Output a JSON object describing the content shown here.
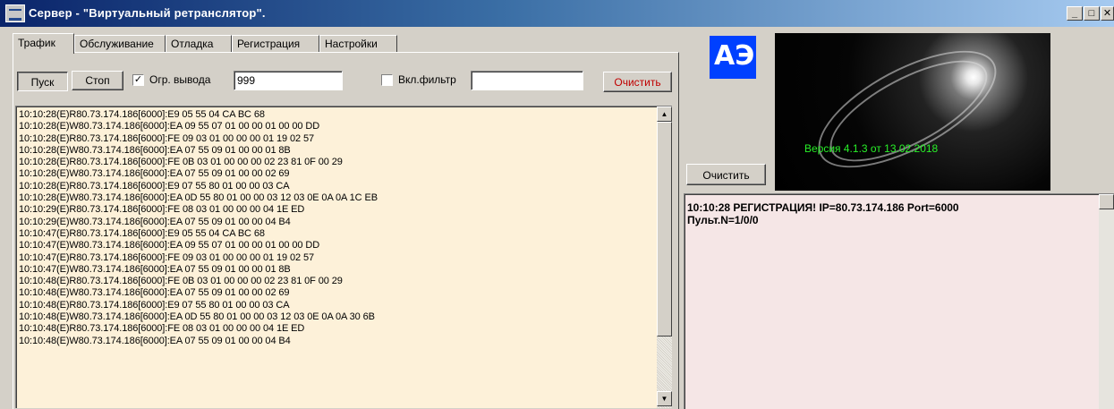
{
  "window": {
    "title": "Сервер - \"Виртуальный ретранслятор\".",
    "min_glyph": "_",
    "max_glyph": "□",
    "close_glyph": "✕"
  },
  "tabs": [
    {
      "label": "Трафик",
      "active": true
    },
    {
      "label": "Обслуживание",
      "active": false
    },
    {
      "label": "Отладка",
      "active": false
    },
    {
      "label": "Регистрация",
      "active": false
    },
    {
      "label": "Настройки",
      "active": false
    }
  ],
  "traffic": {
    "start_label": "Пуск",
    "stop_label": "Стоп",
    "limit_checked": true,
    "limit_label": "Огр. вывода",
    "limit_value": "999",
    "filter_checked": false,
    "filter_label": "Вкл.фильтр",
    "filter_value": "",
    "clear_label": "Очистить",
    "clear_color": "#c00000",
    "log_background": "#fdf1d9",
    "log_lines": [
      "10:10:28(E)R80.73.174.186[6000]:E9 05 55 04 CA BC 68",
      "10:10:28(E)W80.73.174.186[6000]:EA 09 55 07 01 00 00 01 00 00 DD",
      "10:10:28(E)R80.73.174.186[6000]:FE 09 03 01 00 00 00 01 19 02 57",
      "10:10:28(E)W80.73.174.186[6000]:EA 07 55 09 01 00 00 01 8B",
      "10:10:28(E)R80.73.174.186[6000]:FE 0B 03 01 00 00 00 02 23 81 0F 00 29",
      "10:10:28(E)W80.73.174.186[6000]:EA 07 55 09 01 00 00 02 69",
      "10:10:28(E)R80.73.174.186[6000]:E9 07 55 80 01 00 00 03 CA",
      "10:10:28(E)W80.73.174.186[6000]:EA 0D 55 80 01 00 00 03 12 03 0E 0A 0A 1C EB",
      "10:10:29(E)R80.73.174.186[6000]:FE 08 03 01 00 00 00 04 1E ED",
      "10:10:29(E)W80.73.174.186[6000]:EA 07 55 09 01 00 00 04 B4",
      "10:10:47(E)R80.73.174.186[6000]:E9 05 55 04 CA BC 68",
      "10:10:47(E)W80.73.174.186[6000]:EA 09 55 07 01 00 00 01 00 00 DD",
      "10:10:47(E)R80.73.174.186[6000]:FE 09 03 01 00 00 00 01 19 02 57",
      "10:10:47(E)W80.73.174.186[6000]:EA 07 55 09 01 00 00 01 8B",
      "10:10:48(E)R80.73.174.186[6000]:FE 0B 03 01 00 00 00 02 23 81 0F 00 29",
      "10:10:48(E)W80.73.174.186[6000]:EA 07 55 09 01 00 00 02 69",
      "10:10:48(E)R80.73.174.186[6000]:E9 07 55 80 01 00 00 03 CA",
      "10:10:48(E)W80.73.174.186[6000]:EA 0D 55 80 01 00 00 03 12 03 0E 0A 0A 30 6B",
      "10:10:48(E)R80.73.174.186[6000]:FE 08 03 01 00 00 00 04 1E ED",
      "10:10:48(E)W80.73.174.186[6000]:EA 07 55 09 01 00 00 04 B4"
    ]
  },
  "right": {
    "logo_text": "АЭ",
    "version_text": "Версия   4.1.3 от 13.02.2018",
    "version_color": "#28f028",
    "clear_label": "Очистить",
    "message_lines": [
      "10:10:28  РЕГИСТРАЦИЯ! IP=80.73.174.186 Port=6000",
      "Пульт.N=1/0/0"
    ],
    "message_background": "#f5e6e6"
  }
}
